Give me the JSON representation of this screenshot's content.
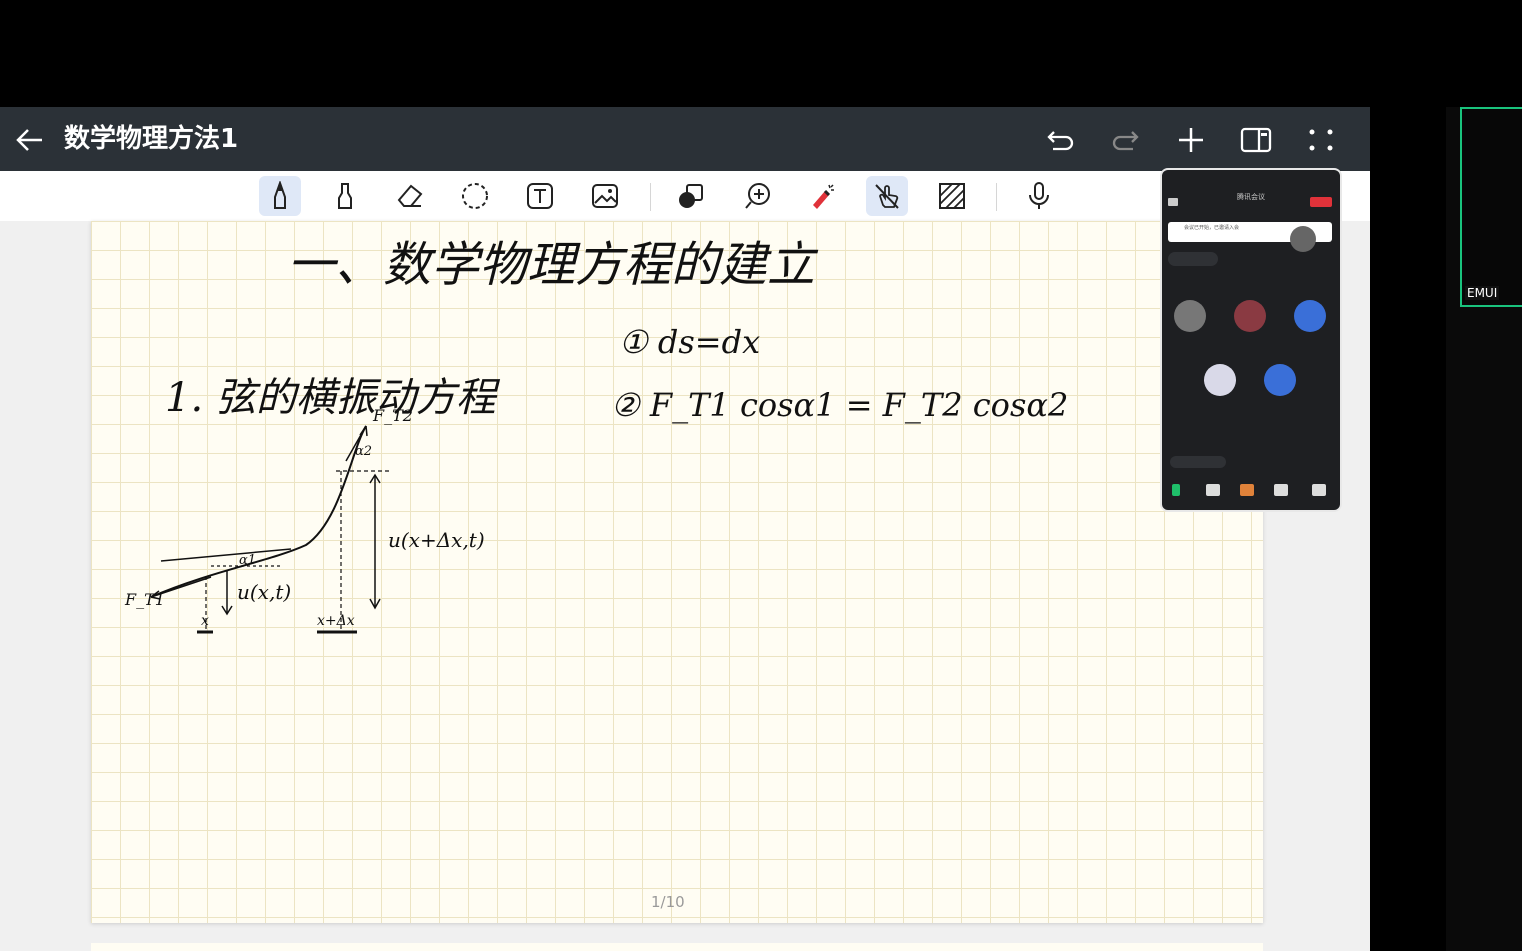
{
  "app": {
    "title": "数学物理方法1",
    "page_indicator": "1/10"
  },
  "toolbar": {
    "tools": [
      "pen-icon",
      "highlighter-icon",
      "eraser-icon",
      "lasso-icon",
      "text-icon",
      "image-icon",
      "shapes-icon",
      "zoom-icon",
      "laser-pointer-icon",
      "touch-draw-icon",
      "pattern-fill-icon",
      "microphone-icon"
    ],
    "active_tool": "pen-icon"
  },
  "note": {
    "heading": "一、数学物理方程的建立",
    "subheading": "1. 弦的横振动方程",
    "eq1": "① ds=dx",
    "eq2": "② F_T1 cosα1 = F_T2 cosα2",
    "label_ft1": "F_T1",
    "label_ft2": "F_T2",
    "label_alpha1": "α1",
    "label_alpha2": "α2",
    "label_u1": "u(x,t)",
    "label_u2": "u(x+Δx,t)",
    "label_x": "x",
    "label_xdx": "x+Δx"
  },
  "meeting": {
    "title": "腾讯会议",
    "notice": "会议已开始，已邀请入会",
    "participants": [
      "",
      "",
      "",
      "",
      ""
    ]
  },
  "monitor": {
    "label": "EMUI"
  },
  "colors": {
    "titlebar": "#2b3137",
    "active_tool_bg": "#dfe8f7",
    "grid": "#ece4c3",
    "page": "#fffdf3",
    "meeting_frame": "#19c37d"
  }
}
